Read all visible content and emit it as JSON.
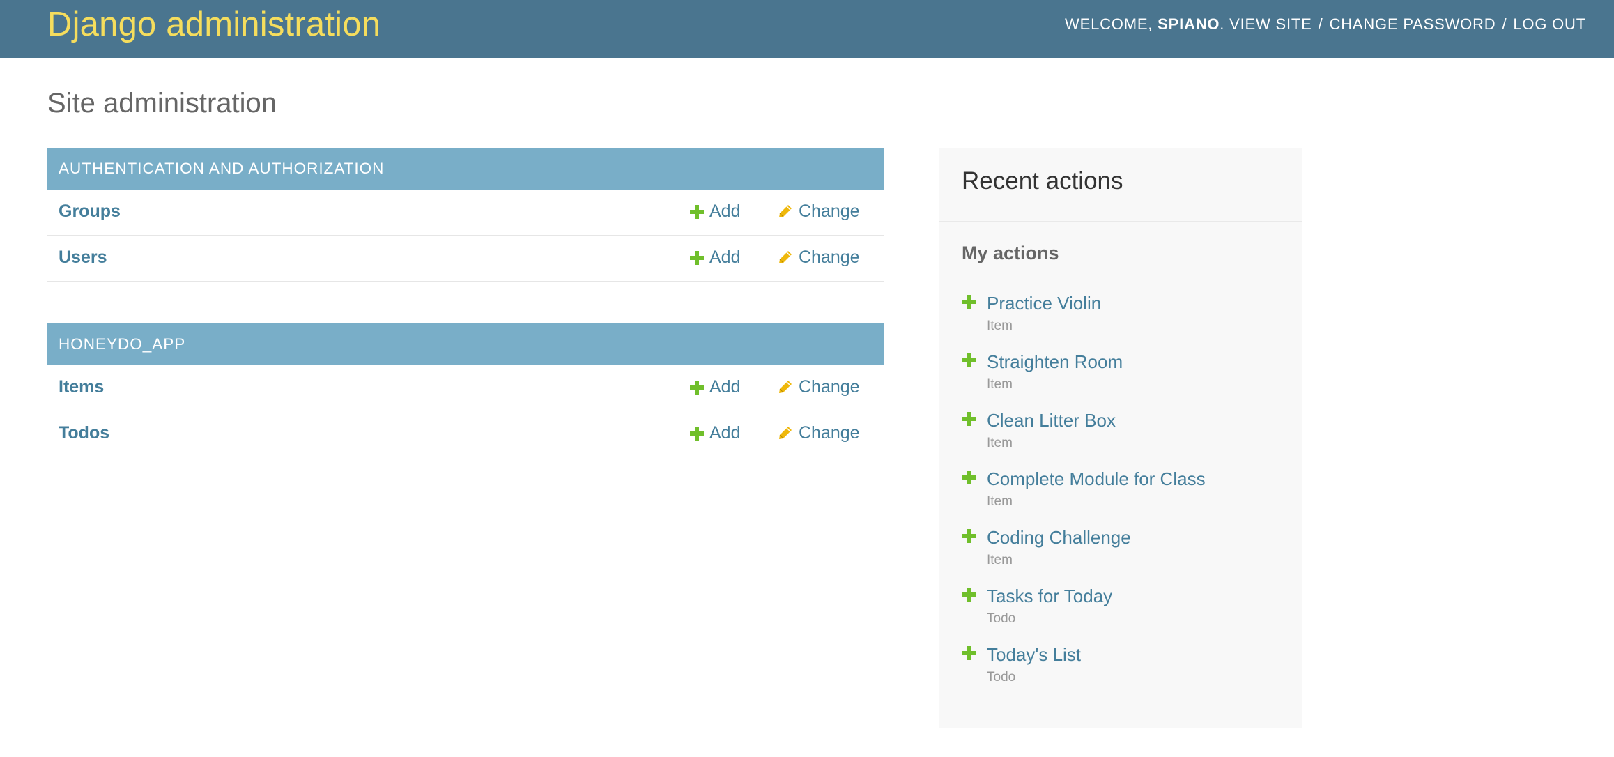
{
  "header": {
    "branding": "Django administration",
    "welcome_prefix": "WELCOME, ",
    "username": "SPIANO",
    "welcome_suffix": ".",
    "view_site": "VIEW SITE",
    "separator": "/",
    "change_password": "CHANGE PASSWORD",
    "log_out": "LOG OUT"
  },
  "page": {
    "title": "Site administration"
  },
  "apps": [
    {
      "caption": "AUTHENTICATION AND AUTHORIZATION",
      "models": [
        {
          "name": "Groups",
          "add_label": "Add",
          "change_label": "Change"
        },
        {
          "name": "Users",
          "add_label": "Add",
          "change_label": "Change"
        }
      ]
    },
    {
      "caption": "HONEYDO_APP",
      "models": [
        {
          "name": "Items",
          "add_label": "Add",
          "change_label": "Change"
        },
        {
          "name": "Todos",
          "add_label": "Add",
          "change_label": "Change"
        }
      ]
    }
  ],
  "recent_actions": {
    "title": "Recent actions",
    "subtitle": "My actions",
    "items": [
      {
        "label": "Practice Violin",
        "type": "Item",
        "icon": "add-icon"
      },
      {
        "label": "Straighten Room",
        "type": "Item",
        "icon": "add-icon"
      },
      {
        "label": "Clean Litter Box",
        "type": "Item",
        "icon": "add-icon"
      },
      {
        "label": "Complete Module for Class",
        "type": "Item",
        "icon": "add-icon"
      },
      {
        "label": "Coding Challenge",
        "type": "Item",
        "icon": "add-icon"
      },
      {
        "label": "Tasks for Today",
        "type": "Todo",
        "icon": "add-icon"
      },
      {
        "label": "Today's List",
        "type": "Todo",
        "icon": "add-icon"
      }
    ]
  },
  "colors": {
    "header_bg": "#4a758f",
    "branding": "#f5dd5d",
    "module_caption_bg": "#79aec8",
    "link": "#447e9b",
    "add_icon": "#70bf2b",
    "change_icon": "#efb80b",
    "recent_bg": "#f8f8f8"
  }
}
